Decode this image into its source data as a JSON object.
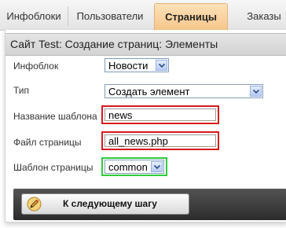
{
  "tabs": [
    {
      "label": "Инфоблоки",
      "active": false
    },
    {
      "label": "Пользователи",
      "active": false
    },
    {
      "label": "Страницы",
      "active": true
    },
    {
      "label": "Заказы",
      "active": false
    }
  ],
  "page": {
    "title": "Сайт Test: Создание страниц: Элементы"
  },
  "form": {
    "infoblock": {
      "label": "Инфоблок",
      "value": "Новости"
    },
    "type": {
      "label": "Тип",
      "value": "Создать элемент"
    },
    "template_name": {
      "label": "Название шаблона",
      "value": "news"
    },
    "page_file": {
      "label": "Файл страницы",
      "value": "all_news.php"
    },
    "page_template": {
      "label": "Шаблон страницы",
      "value": "common"
    }
  },
  "actions": {
    "next_label": "К следующему шагу",
    "next_icon": "pencil-icon"
  },
  "colors": {
    "active_tab": "#f7c68a",
    "highlight_red": "#d7191f",
    "highlight_green": "#2fcc3a",
    "button_bar": "#3a3a3a"
  }
}
